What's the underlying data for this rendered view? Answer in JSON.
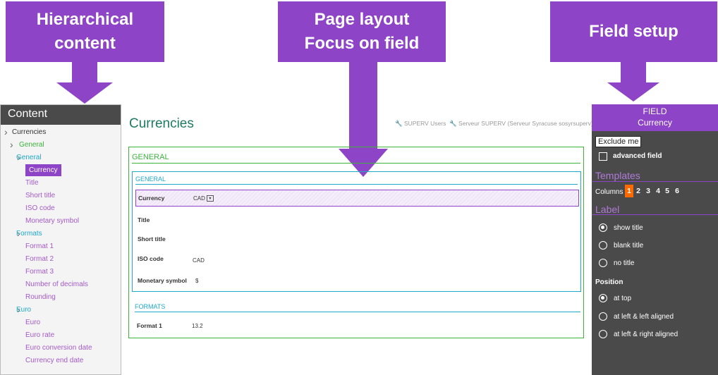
{
  "callouts": {
    "left": [
      "Hierarchical",
      "content"
    ],
    "middle": [
      "Page layout",
      "Focus on field"
    ],
    "right": [
      "Field setup"
    ]
  },
  "left_panel": {
    "header": "Content",
    "tree": [
      {
        "label": "Currencies",
        "chevron": true,
        "level": 0,
        "style": "dark"
      },
      {
        "label": "General",
        "chevron": true,
        "level": 1,
        "style": "green"
      },
      {
        "label": "General",
        "chevron": true,
        "level": 2,
        "style": "teal"
      },
      {
        "label": "Currency",
        "chevron": false,
        "level": 3,
        "style": "selected"
      },
      {
        "label": "Title",
        "chevron": false,
        "level": 3,
        "style": "purple"
      },
      {
        "label": "Short title",
        "chevron": false,
        "level": 3,
        "style": "purple"
      },
      {
        "label": "ISO code",
        "chevron": false,
        "level": 3,
        "style": "purple"
      },
      {
        "label": "Monetary symbol",
        "chevron": false,
        "level": 3,
        "style": "purple"
      },
      {
        "label": "Formats",
        "chevron": true,
        "level": 2,
        "style": "teal"
      },
      {
        "label": "Format 1",
        "chevron": false,
        "level": 3,
        "style": "purple"
      },
      {
        "label": "Format 2",
        "chevron": false,
        "level": 3,
        "style": "purple"
      },
      {
        "label": "Format 3",
        "chevron": false,
        "level": 3,
        "style": "purple"
      },
      {
        "label": "Number of decimals",
        "chevron": false,
        "level": 3,
        "style": "purple"
      },
      {
        "label": "Rounding",
        "chevron": false,
        "level": 3,
        "style": "purple"
      },
      {
        "label": "Euro",
        "chevron": true,
        "level": 2,
        "style": "teal"
      },
      {
        "label": "Euro",
        "chevron": false,
        "level": 3,
        "style": "purple"
      },
      {
        "label": "Euro rate",
        "chevron": false,
        "level": 3,
        "style": "purple"
      },
      {
        "label": "Euro conversion date",
        "chevron": false,
        "level": 3,
        "style": "purple"
      },
      {
        "label": "Currency end date",
        "chevron": false,
        "level": 3,
        "style": "purple"
      }
    ]
  },
  "page": {
    "title": "Currencies",
    "user_link": "SUPERV Users",
    "server_link": "Serveur SUPERV (Serveur Syracuse sosyrsuperv)",
    "general_outer_title": "GENERAL",
    "general_inner_title": "GENERAL",
    "fields": [
      {
        "label": "Currency",
        "value": "CAD",
        "caret": "▾"
      },
      {
        "label": "Title",
        "value": ""
      },
      {
        "label": "Short title",
        "value": ""
      },
      {
        "label": "ISO code",
        "value": "CAD"
      },
      {
        "label": "Monetary symbol",
        "value": "$"
      }
    ],
    "formats_title": "FORMATS",
    "formats_fields": [
      {
        "label": "Format 1",
        "value": "13.2"
      }
    ]
  },
  "right_panel": {
    "title": "FIELD",
    "subtitle": "Currency",
    "exclude_label": "Exclude me",
    "advanced_label": "advanced field",
    "templates_title": "Templates",
    "columns_label": "Columns",
    "columns": [
      "1",
      "2",
      "3",
      "4",
      "5",
      "6"
    ],
    "active_column": "1",
    "label_title": "Label",
    "label_options": [
      {
        "label": "show title",
        "selected": true
      },
      {
        "label": "blank title",
        "selected": false
      },
      {
        "label": "no title",
        "selected": false
      }
    ],
    "position_title": "Position",
    "position_options": [
      {
        "label": "at top",
        "selected": true
      },
      {
        "label": "at left & left aligned",
        "selected": false
      },
      {
        "label": "at left & right aligned",
        "selected": false
      }
    ]
  },
  "colors": {
    "accent_purple": "#8e44c6",
    "green": "#3cb43c",
    "teal": "#1ea9c8",
    "orange": "#ff6a00",
    "panel_dark": "#4a4a4a"
  },
  "icons": {
    "tree_chevron": "chevron-right-icon",
    "user": "wrench-icon",
    "server": "wrench-icon"
  }
}
